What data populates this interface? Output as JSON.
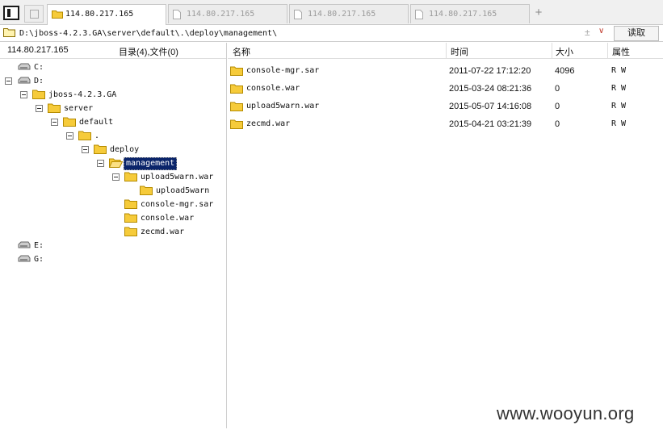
{
  "tabs": [
    {
      "label": "114.80.217.165",
      "active": true
    },
    {
      "label": "114.80.217.165",
      "active": false
    },
    {
      "label": "114.80.217.165",
      "active": false
    },
    {
      "label": "114.80.217.165",
      "active": false
    }
  ],
  "address": {
    "path": "D:\\jboss-4.2.3.GA\\server\\default\\.\\deploy\\management\\",
    "read_button": "读取"
  },
  "left_header": {
    "host": "114.80.217.165",
    "counts": "目录(4),文件(0)"
  },
  "tree": {
    "drive_c": "C:",
    "drive_d": "D:",
    "jboss": "jboss-4.2.3.GA",
    "server": "server",
    "default": "default",
    "dot": ".",
    "deploy": "deploy",
    "management": "management",
    "upload5warn_war": "upload5warn.war",
    "upload5warn": "upload5warn",
    "console_mgr": "console-mgr.sar",
    "console_war": "console.war",
    "zecmd": "zecmd.war",
    "drive_e": "E:",
    "drive_g": "G:"
  },
  "columns": {
    "name": "名称",
    "time": "时间",
    "size": "大小",
    "attr": "属性"
  },
  "files": [
    {
      "name": "console-mgr.sar",
      "time": "2011-07-22 17:12:20",
      "size": "4096",
      "attr": "R W"
    },
    {
      "name": "console.war",
      "time": "2015-03-24 08:21:36",
      "size": "0",
      "attr": "R W"
    },
    {
      "name": "upload5warn.war",
      "time": "2015-05-07 14:16:08",
      "size": "0",
      "attr": "R W"
    },
    {
      "name": "zecmd.war",
      "time": "2015-04-21 03:21:39",
      "size": "0",
      "attr": "R W"
    }
  ],
  "watermark": "www.wooyun.org",
  "icons": {
    "folder": "folder-icon",
    "drive": "drive-icon",
    "doc": "document-icon"
  },
  "colors": {
    "selection": "#0a246a",
    "folder": "#f5c518"
  }
}
